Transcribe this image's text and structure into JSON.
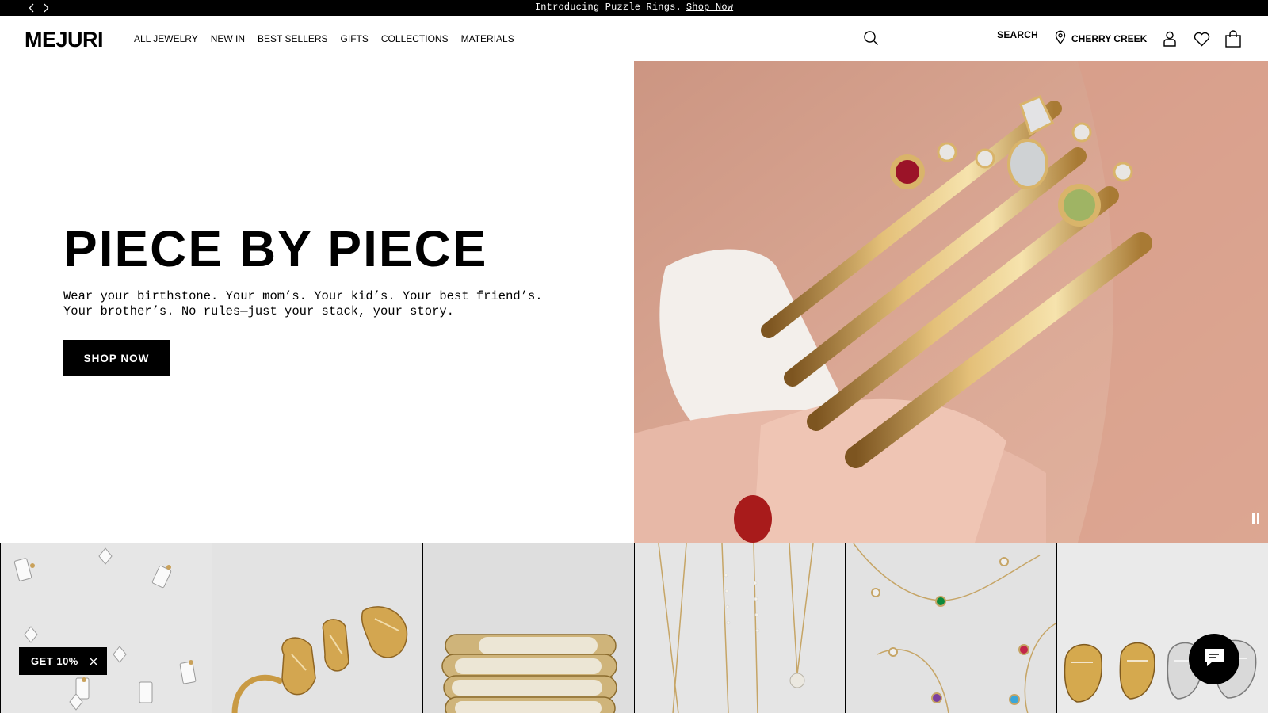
{
  "announcement": {
    "message": "Introducing Puzzle Rings.",
    "link": "Shop Now"
  },
  "header": {
    "logo": "MEJURI",
    "nav": [
      "ALL JEWELRY",
      "NEW IN",
      "BEST SELLERS",
      "GIFTS",
      "COLLECTIONS",
      "MATERIALS"
    ],
    "search": {
      "placeholder": "",
      "button": "SEARCH"
    },
    "location": "CHERRY CREEK"
  },
  "hero": {
    "title": "PIECE BY PIECE",
    "subtitle_line1": "Wear your birthstone. Your mom’s. Your kid’s. Your best friend’s.",
    "subtitle_line2": "Your brother’s. No rules—just your stack, your story.",
    "cta": "SHOP NOW"
  },
  "promo": {
    "label": "GET 10%"
  },
  "colors": {
    "brand": "#000000",
    "background": "#ffffff",
    "tile_bg": "#e4e4e4",
    "gold": "#c9a15a"
  }
}
